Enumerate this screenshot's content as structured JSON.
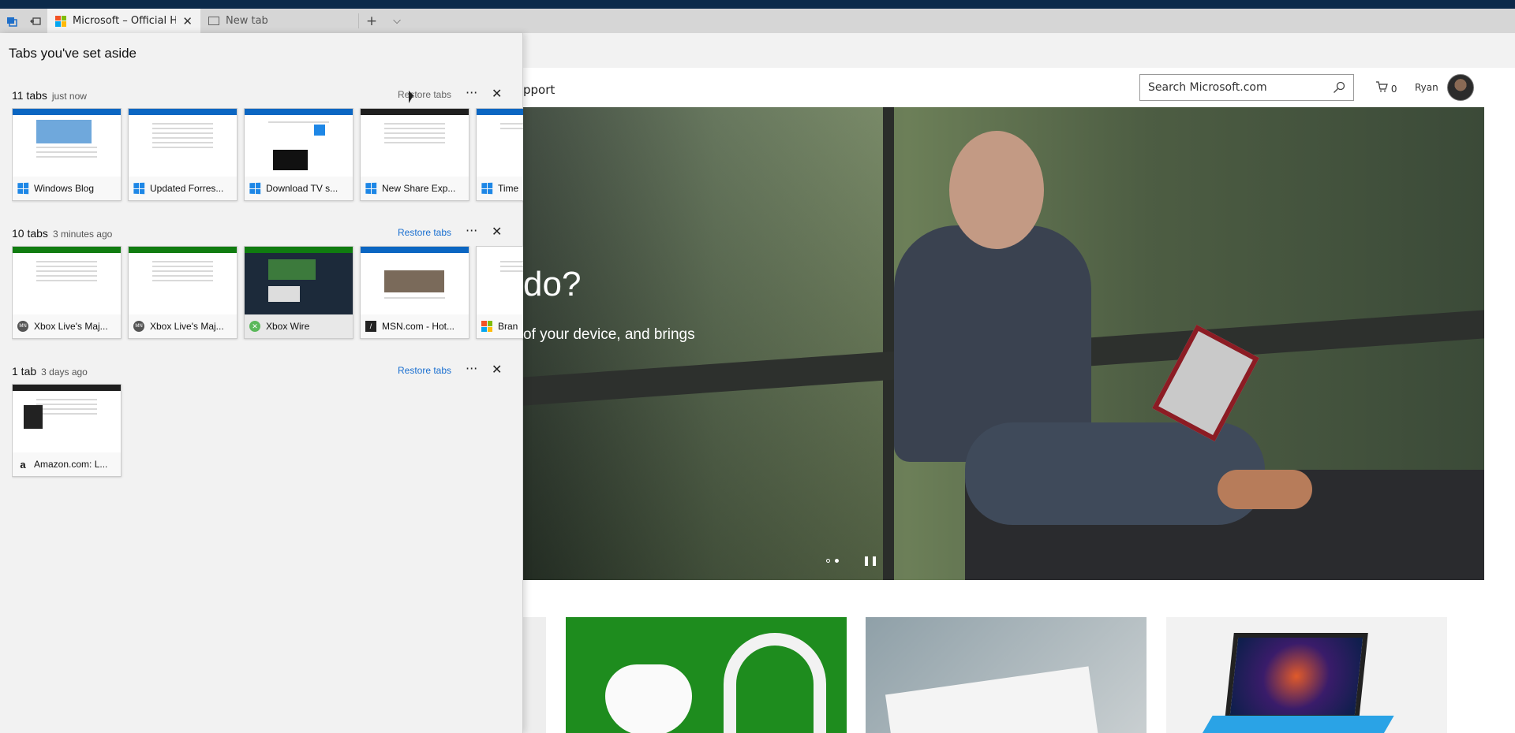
{
  "browser": {
    "tabs": [
      {
        "title": "Microsoft – Official Hon",
        "active": true
      },
      {
        "title": "New tab",
        "active": false
      }
    ],
    "new_tab_symbol": "+",
    "tab_list_symbol": "⌵"
  },
  "site": {
    "nav_partial": "pport",
    "search_placeholder": "Search Microsoft.com",
    "cart_count": "0",
    "user_name": "Ryan",
    "hero_title_partial": "do?",
    "hero_subtitle_partial": "of your device, and brings"
  },
  "panel": {
    "title": "Tabs you've set aside",
    "restore_label": "Restore tabs",
    "more_symbol": "···",
    "close_symbol": "✕",
    "groups": [
      {
        "count": "11 tabs",
        "time": "just now",
        "tabs": [
          {
            "title": "Windows Blog",
            "icon": "windows-icon"
          },
          {
            "title": "Updated Forres...",
            "icon": "windows-icon"
          },
          {
            "title": "Download TV s...",
            "icon": "windows-icon"
          },
          {
            "title": "New Share Exp...",
            "icon": "windows-icon"
          },
          {
            "title": "Time",
            "icon": "windows-icon"
          }
        ]
      },
      {
        "count": "10 tabs",
        "time": "3 minutes ago",
        "tabs": [
          {
            "title": "Xbox Live's Maj...",
            "icon": "major-nelson-icon"
          },
          {
            "title": "Xbox Live's Maj...",
            "icon": "major-nelson-icon"
          },
          {
            "title": "Xbox Wire",
            "icon": "xbox-icon"
          },
          {
            "title": "MSN.com - Hot...",
            "icon": "msn-icon"
          },
          {
            "title": "Bran",
            "icon": "microsoft-icon"
          }
        ]
      },
      {
        "count": "1 tab",
        "time": "3 days ago",
        "tabs": [
          {
            "title": "Amazon.com: L...",
            "icon": "amazon-icon"
          }
        ]
      }
    ]
  }
}
